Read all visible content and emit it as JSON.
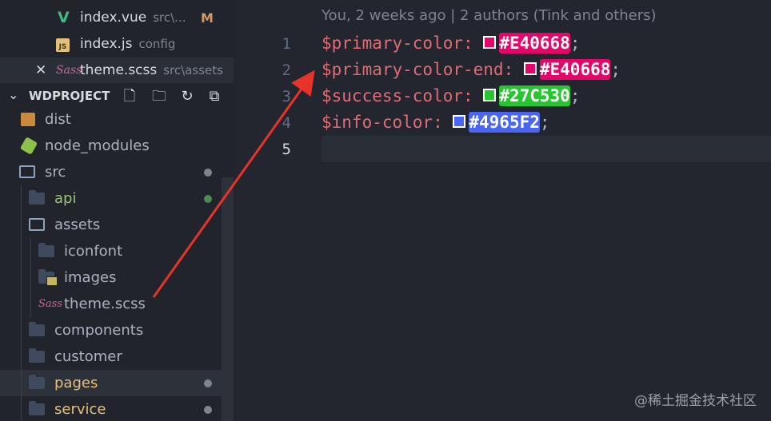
{
  "open_editors": [
    {
      "icon": "vue-icon",
      "glyph": "V",
      "name": "index.vue",
      "desc": "src\\...",
      "badge": "M"
    },
    {
      "icon": "js-icon",
      "glyph": "JS",
      "name": "index.js",
      "desc": "config",
      "badge": ""
    },
    {
      "icon": "sass-icon",
      "glyph": "Sass",
      "name": "theme.scss",
      "desc": "src\\assets",
      "badge": "",
      "close": "✕"
    }
  ],
  "project": {
    "title": "WDPROJECT",
    "chevron": "⌄",
    "toolbar": {
      "new_file": "🗋",
      "new_folder": "🗀",
      "refresh": "↻",
      "collapse": "⧉"
    }
  },
  "tree": [
    {
      "label": "dist",
      "color": "#abb2bf",
      "status": ""
    },
    {
      "label": "node_modules",
      "color": "#abb2bf",
      "status": ""
    },
    {
      "label": "src",
      "color": "#abb2bf",
      "status": "modified"
    },
    {
      "label": "api",
      "color": "#98c379",
      "status": "added"
    },
    {
      "label": "assets",
      "color": "#abb2bf",
      "status": ""
    },
    {
      "label": "iconfont",
      "color": "#abb2bf",
      "status": ""
    },
    {
      "label": "images",
      "color": "#abb2bf",
      "status": ""
    },
    {
      "label": "theme.scss",
      "color": "#abb2bf",
      "status": ""
    },
    {
      "label": "components",
      "color": "#abb2bf",
      "status": ""
    },
    {
      "label": "customer",
      "color": "#abb2bf",
      "status": ""
    },
    {
      "label": "pages",
      "color": "#e5c07b",
      "status": "modified"
    },
    {
      "label": "service",
      "color": "#e5c07b",
      "status": "modified"
    }
  ],
  "editor": {
    "blame": "You, 2 weeks ago | 2 authors (Tink and others)",
    "line_numbers": [
      "1",
      "2",
      "3",
      "4",
      "5"
    ],
    "lines": [
      {
        "variable": "$primary-color:",
        "value": "#E40668",
        "color": "#E40668",
        "end": ";"
      },
      {
        "variable": "$primary-color-end:",
        "value": "#E40668",
        "color": "#E40668",
        "end": ";"
      },
      {
        "variable": "$success-color:",
        "value": "#27C530",
        "color": "#27C530",
        "end": ";"
      },
      {
        "variable": "$info-color:",
        "value": "#4965F2",
        "color": "#4965F2",
        "end": ";"
      }
    ]
  },
  "watermark": "@稀土掘金技术社区",
  "colors": {
    "annotation_arrow": "#e8332a",
    "accent": "#42b883"
  }
}
